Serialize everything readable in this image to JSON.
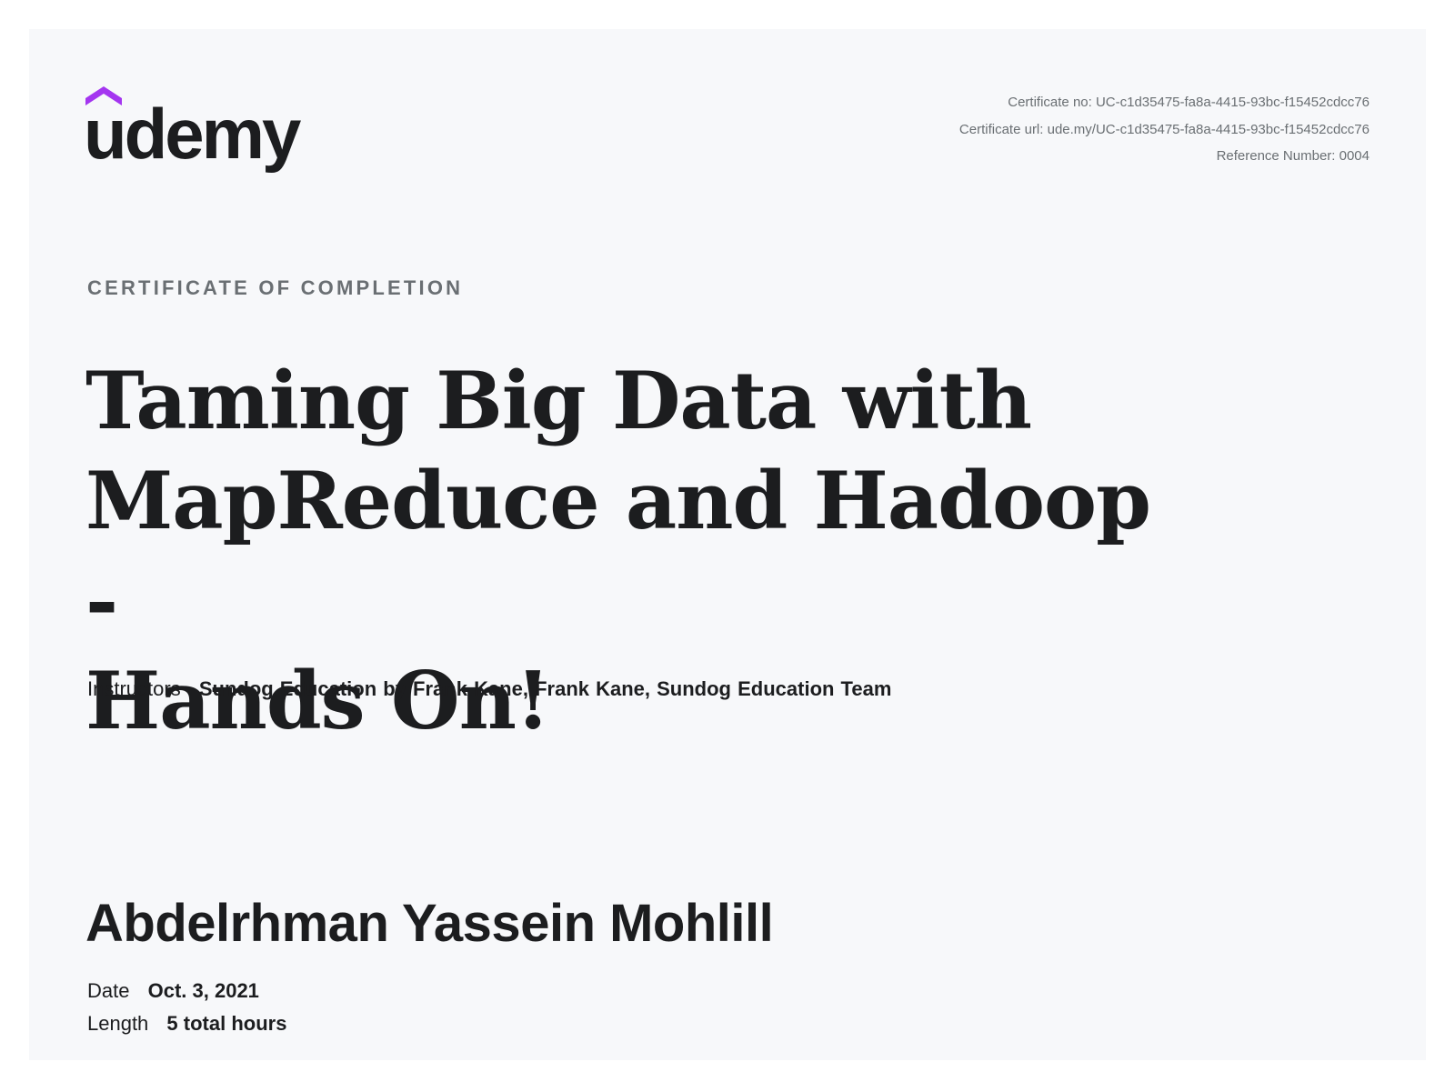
{
  "brand": {
    "logo_text": "udemy",
    "logo_color": "#1c1d1f",
    "accent_color": "#a435f0"
  },
  "meta": {
    "certificate_no": "Certificate no: UC-c1d35475-fa8a-4415-93bc-f15452cdcc76",
    "certificate_url": "Certificate url: ude.my/UC-c1d35475-fa8a-4415-93bc-f15452cdcc76",
    "reference_number": "Reference Number: 0004"
  },
  "certificate": {
    "kicker": "CERTIFICATE OF COMPLETION",
    "title_lines": [
      "Taming Big Data with",
      "MapReduce and Hadoop -",
      "Hands On!"
    ]
  },
  "instructors": {
    "label": "Instructors",
    "names": "Sundog Education by Frank Kane,  Frank Kane,  Sundog Education Team"
  },
  "recipient": {
    "name": "Abdelrhman Yassein Mohlill"
  },
  "details": {
    "date_label": "Date",
    "date_value": "Oct. 3, 2021",
    "length_label": "Length",
    "length_value": "5 total hours"
  },
  "colors": {
    "page_bg": "#ffffff",
    "card_bg": "#f7f8fa",
    "text_primary": "#1c1d1f",
    "text_muted": "#6a6f73"
  }
}
